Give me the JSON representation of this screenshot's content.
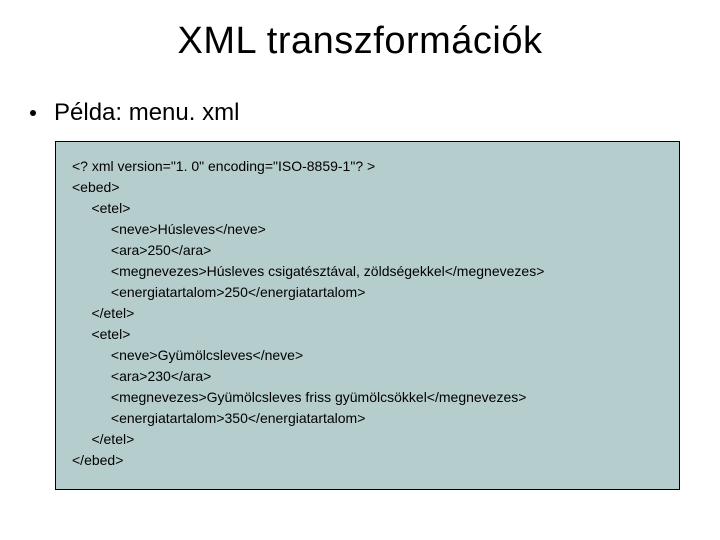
{
  "title": "XML transzformációk",
  "bullet": "Példa: menu. xml",
  "code": "<? xml version=\"1. 0\" encoding=\"ISO-8859-1\"? >\n<ebed>\n     <etel>\n          <neve>Húsleves</neve>\n          <ara>250</ara>\n          <megnevezes>Húsleves csigatésztával, zöldségekkel</megnevezes>\n          <energiatartalom>250</energiatartalom>\n     </etel>\n     <etel>\n          <neve>Gyümölcsleves</neve>\n          <ara>230</ara>\n          <megnevezes>Gyümölcsleves friss gyümölcsökkel</megnevezes>\n          <energiatartalom>350</energiatartalom>\n     </etel>\n</ebed>"
}
